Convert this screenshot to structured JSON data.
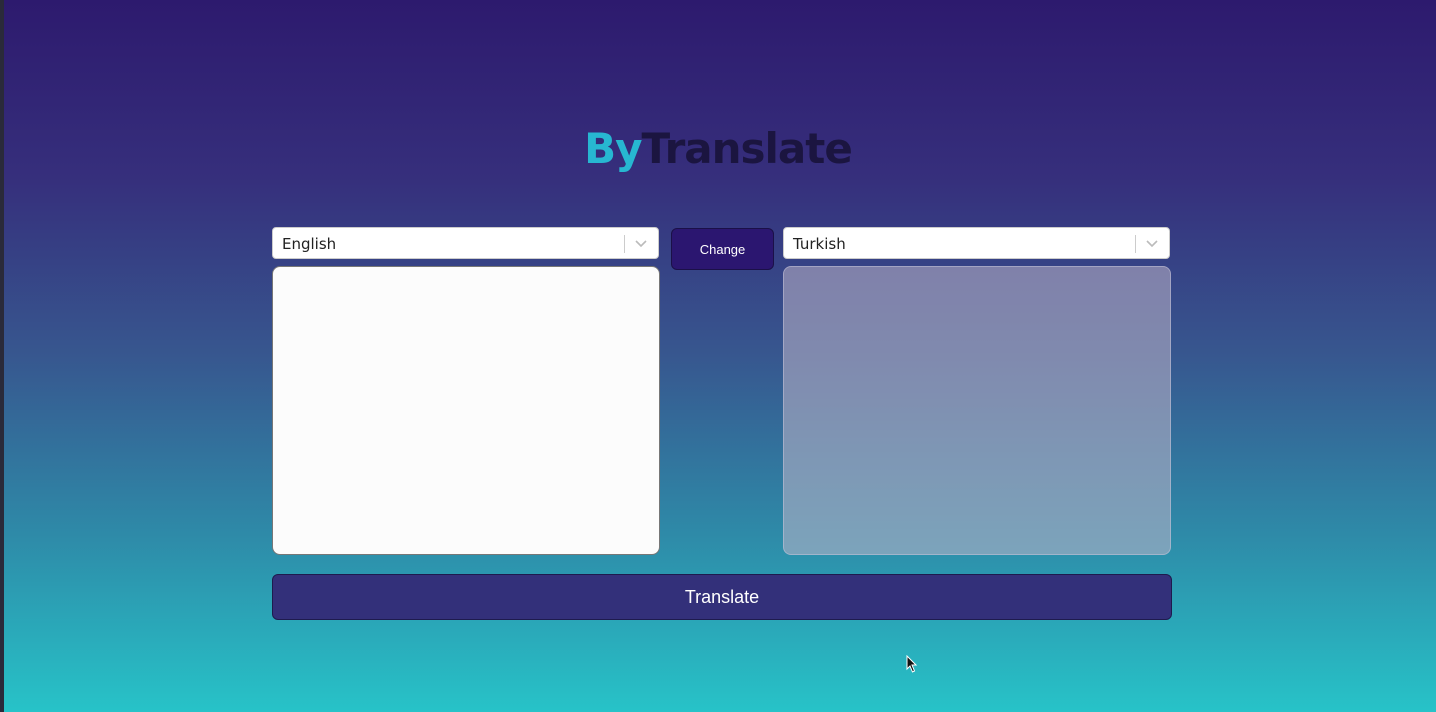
{
  "logo": {
    "part1": "By",
    "part2": "Translate"
  },
  "source_language": {
    "selected": "English"
  },
  "target_language": {
    "selected": "Turkish"
  },
  "change_button": {
    "label": "Change"
  },
  "source_text": {
    "value": ""
  },
  "target_text": {
    "value": ""
  },
  "translate_button": {
    "label": "Translate"
  },
  "icons": {
    "select_arrow": "chevron-down-icon",
    "pointer": "cursor-arrow-icon"
  },
  "colors": {
    "logo_accent": "#27b7d1",
    "logo_dark": "#1b1540",
    "button": "#2b1670",
    "translate_button": "#33307a"
  }
}
